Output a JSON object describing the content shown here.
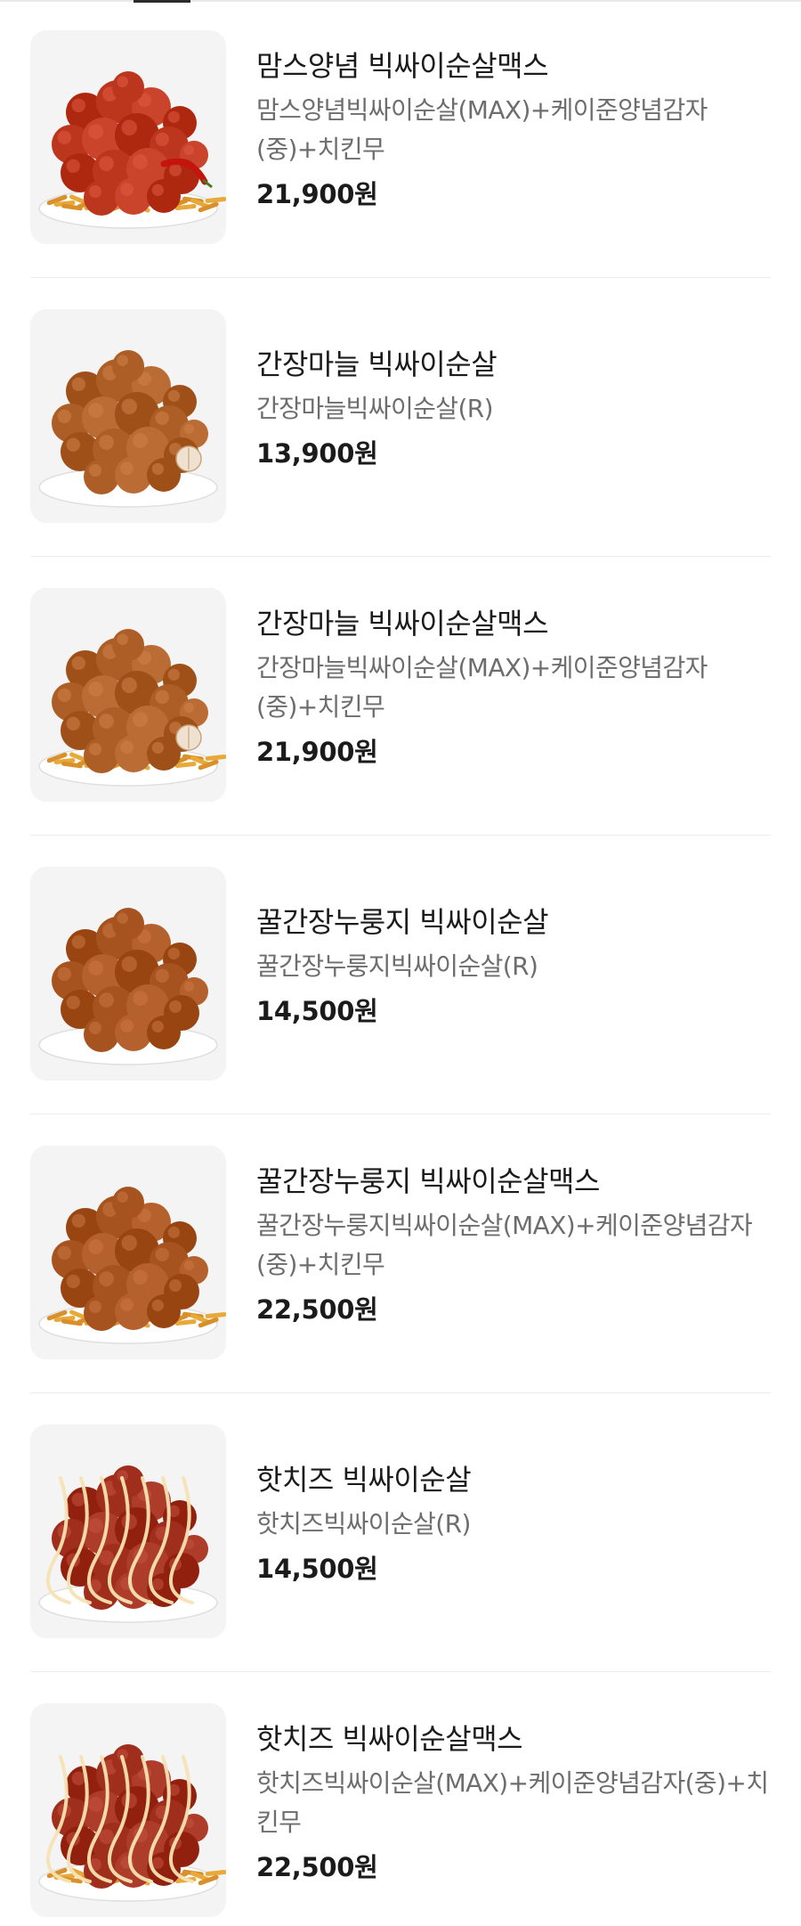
{
  "menu": {
    "items": [
      {
        "name": "맘스양념 빅싸이순살맥스",
        "description": "맘스양념빅싸이순살(MAX)+케이준양념감자(중)+치킨무",
        "price": "21,900원",
        "image": {
          "sauce": "spicy-red",
          "fries": true,
          "garnish": "pepper"
        }
      },
      {
        "name": "간장마늘 빅싸이순살",
        "description": "간장마늘빅싸이순살(R)",
        "price": "13,900원",
        "image": {
          "sauce": "soy-garlic",
          "fries": false,
          "garnish": "garlic"
        }
      },
      {
        "name": "간장마늘 빅싸이순살맥스",
        "description": "간장마늘빅싸이순살(MAX)+케이준양념감자(중)+치킨무",
        "price": "21,900원",
        "image": {
          "sauce": "soy-garlic",
          "fries": true,
          "garnish": "garlic"
        }
      },
      {
        "name": "꿀간장누룽지 빅싸이순살",
        "description": "꿀간장누룽지빅싸이순살(R)",
        "price": "14,500원",
        "image": {
          "sauce": "honey-soy",
          "fries": false,
          "garnish": "none"
        }
      },
      {
        "name": "꿀간장누룽지 빅싸이순살맥스",
        "description": "꿀간장누룽지빅싸이순살(MAX)+케이준양념감자(중)+치킨무",
        "price": "22,500원",
        "image": {
          "sauce": "honey-soy",
          "fries": true,
          "garnish": "none"
        }
      },
      {
        "name": "핫치즈 빅싸이순살",
        "description": "핫치즈빅싸이순살(R)",
        "price": "14,500원",
        "image": {
          "sauce": "hot-cheese",
          "fries": false,
          "garnish": "mayo-drizzle"
        }
      },
      {
        "name": "핫치즈 빅싸이순살맥스",
        "description": "핫치즈빅싸이순살(MAX)+케이준양념감자(중)+치킨무",
        "price": "22,500원",
        "image": {
          "sauce": "hot-cheese",
          "fries": true,
          "garnish": "mayo-drizzle"
        }
      }
    ]
  },
  "colors": {
    "background": "#ffffff",
    "thumb_background": "#f4f4f4",
    "name": "#1b1b1b",
    "description": "#6d6d6d",
    "price": "#1b1b1b",
    "divider": "#ececec",
    "spicy-red": "#b8321a",
    "soy-garlic": "#a85a22",
    "honey-soy": "#a34f1c",
    "hot-cheese": "#9c2a18"
  }
}
